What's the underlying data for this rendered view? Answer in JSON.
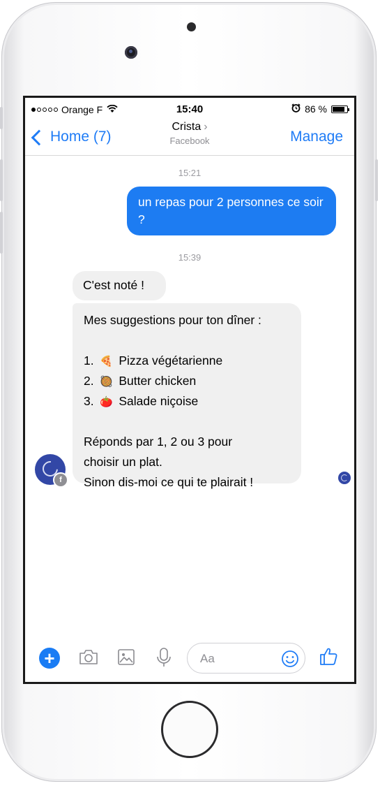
{
  "status_bar": {
    "carrier": "Orange F",
    "time": "15:40",
    "battery": "86 %"
  },
  "nav": {
    "back_label": "Home (7)",
    "contact_name": "Crista",
    "subtitle": "Facebook",
    "manage_label": "Manage"
  },
  "conversation": {
    "timestamp_1": "15:21",
    "outgoing_message": "un repas pour 2 personnes ce soir ?",
    "timestamp_2": "15:39",
    "incoming_1": "C'est noté !",
    "incoming_2": {
      "intro": "Mes suggestions pour ton dîner :",
      "items": [
        {
          "number": "1.",
          "emoji": "🍕",
          "label": "Pizza végétarienne"
        },
        {
          "number": "2.",
          "emoji": "🥘",
          "label": "Butter chicken"
        },
        {
          "number": "3.",
          "emoji": "🍅",
          "label": "Salade niçoise"
        }
      ],
      "footer_line_1": "Réponds par 1, 2 ou 3 pour",
      "footer_line_2": "choisir un plat.",
      "footer_line_3": "Sinon dis-moi ce qui te plairait !"
    }
  },
  "composer": {
    "placeholder": "Aa",
    "icons": [
      "plus-icon",
      "camera-icon",
      "image-icon",
      "microphone-icon",
      "emoji-icon",
      "thumbs-up-icon"
    ]
  },
  "colors": {
    "accent": "#1f7cf6",
    "outgoing_bubble": "#1d7cf2",
    "incoming_bubble": "#f0f0f0",
    "avatar": "#3247a6"
  }
}
